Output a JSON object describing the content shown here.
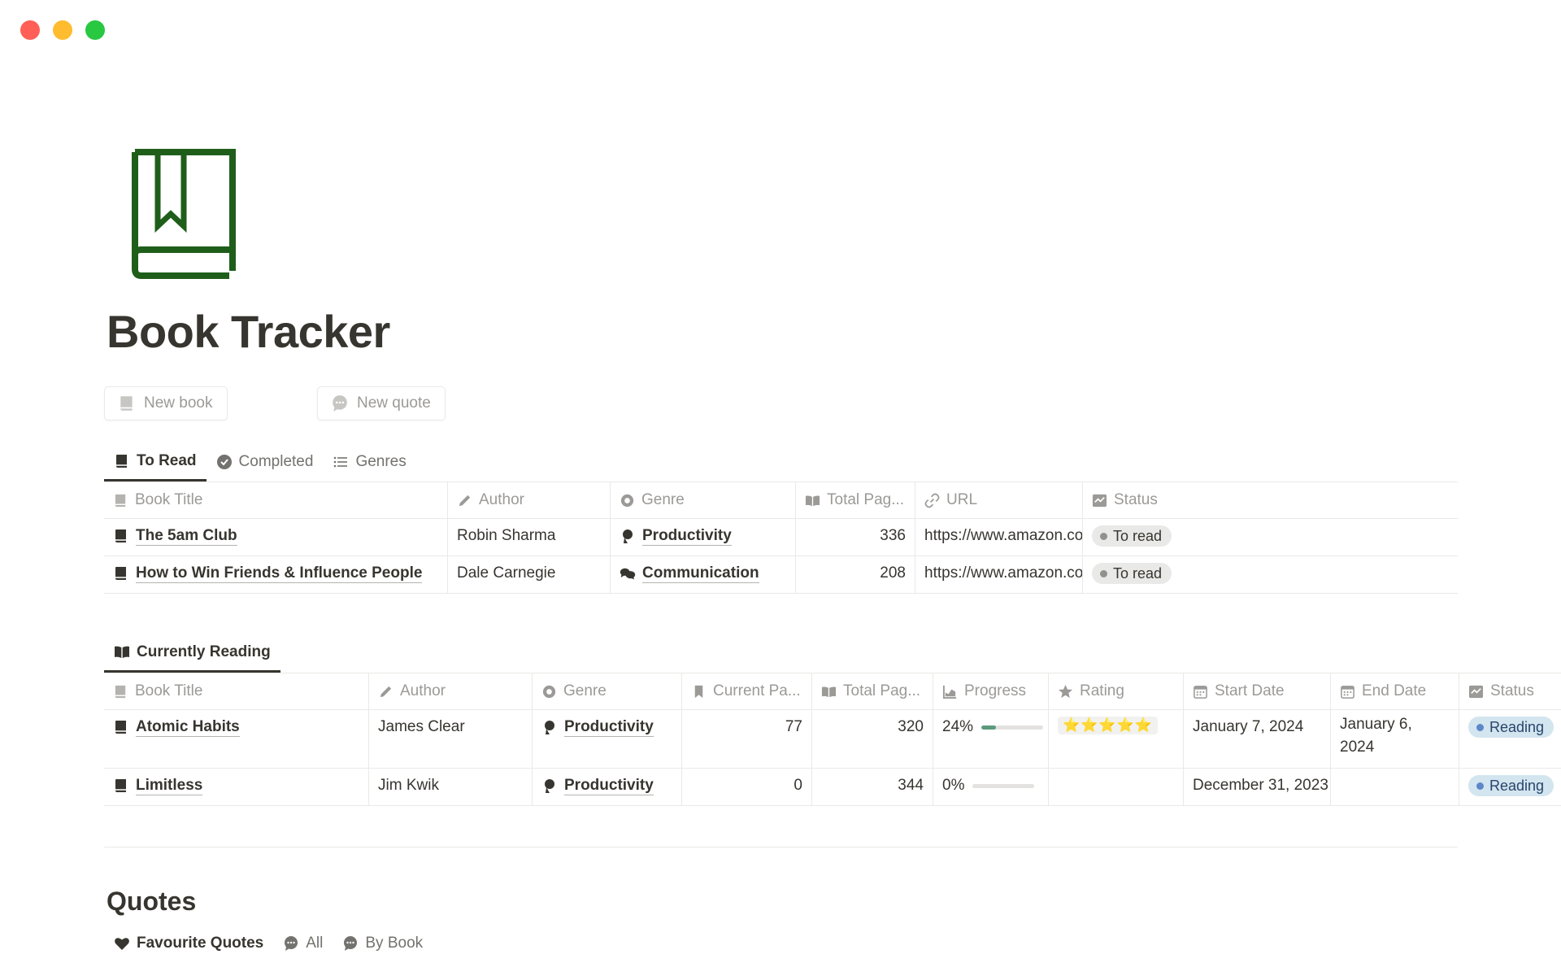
{
  "page": {
    "title": "Book Tracker",
    "icon": "book-bookmark-icon",
    "accent_color": "#1f5e1a"
  },
  "buttons": {
    "new_book": "New book",
    "new_quote": "New quote"
  },
  "to_read_view": {
    "tabs": [
      {
        "label": "To Read",
        "icon": "book-icon",
        "active": true
      },
      {
        "label": "Completed",
        "icon": "check-circle-icon",
        "active": false
      },
      {
        "label": "Genres",
        "icon": "list-icon",
        "active": false
      }
    ],
    "columns": [
      "Book Title",
      "Author",
      "Genre",
      "Total Pag...",
      "URL",
      "Status"
    ],
    "rows": [
      {
        "title": "The 5am Club",
        "author": "Robin Sharma",
        "genre": "Productivity",
        "total_pages": "336",
        "url": "https://www.amazon.co",
        "status": "To read"
      },
      {
        "title": "How to Win Friends & Influence People",
        "author": "Dale Carnegie",
        "genre": "Communication",
        "total_pages": "208",
        "url": "https://www.amazon.co",
        "status": "To read"
      }
    ]
  },
  "reading_view": {
    "tab": "Currently Reading",
    "columns": [
      "Book Title",
      "Author",
      "Genre",
      "Current Pa...",
      "Total Pag...",
      "Progress",
      "Rating",
      "Start Date",
      "End Date",
      "Status"
    ],
    "rows": [
      {
        "title": "Atomic Habits",
        "author": "James Clear",
        "genre": "Productivity",
        "current_page": "77",
        "total_pages": "320",
        "progress": "24%",
        "progress_value": 0.24,
        "rating": "⭐⭐⭐⭐⭐",
        "start_date": "January 7, 2024",
        "end_date": "January 6, 2024",
        "status": "Reading"
      },
      {
        "title": "Limitless",
        "author": "Jim Kwik",
        "genre": "Productivity",
        "current_page": "0",
        "total_pages": "344",
        "progress": "0%",
        "progress_value": 0,
        "rating": "",
        "start_date": "December 31, 2023",
        "end_date": "",
        "status": "Reading"
      }
    ]
  },
  "quotes": {
    "title": "Quotes",
    "tabs": [
      {
        "label": "Favourite Quotes",
        "icon": "heart-icon"
      },
      {
        "label": "All",
        "icon": "speech-bubble-icon"
      },
      {
        "label": "By Book",
        "icon": "speech-bubble-icon"
      }
    ]
  }
}
